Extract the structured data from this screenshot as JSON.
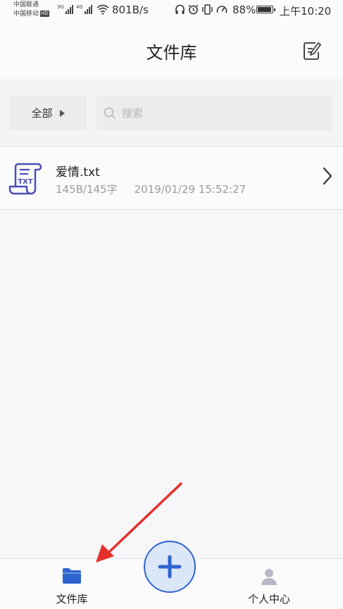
{
  "status_bar": {
    "carrier1": "中国联通",
    "carrier2": "中国移动",
    "hd": "HD",
    "net1": "3G",
    "net2": "4G",
    "speed": "801B/s",
    "battery": "88%",
    "time": "上午10:20"
  },
  "header": {
    "title": "文件库"
  },
  "filter": {
    "all_label": "全部",
    "search_placeholder": "搜索"
  },
  "files": [
    {
      "name": "爱情.txt",
      "size": "145B/145字",
      "date": "2019/01/29 15:52:27",
      "icon_text": "TXT"
    }
  ],
  "bottom_nav": {
    "files_label": "文件库",
    "profile_label": "个人中心"
  },
  "colors": {
    "accent": "#2e64cf",
    "fab_fill": "#dbe6f7",
    "file_icon": "#4b4db5",
    "annotation_arrow": "#e5302b"
  }
}
